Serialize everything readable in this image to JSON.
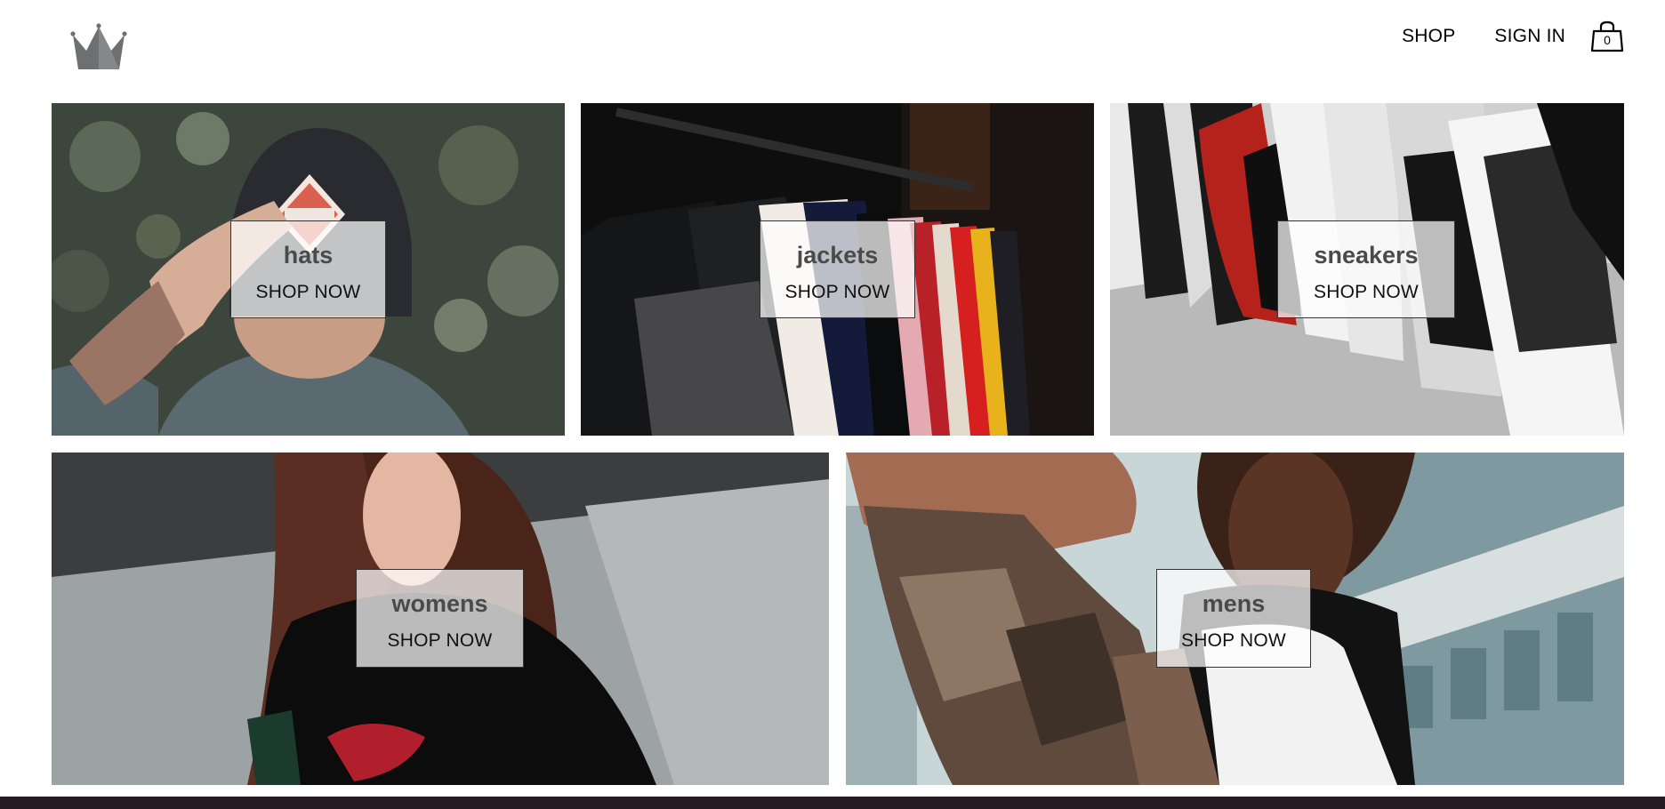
{
  "header": {
    "logo_icon": "crown-icon",
    "nav": {
      "shop_label": "SHOP",
      "signin_label": "SIGN IN"
    },
    "cart": {
      "icon": "shopping-bag-icon",
      "count": "0"
    }
  },
  "directory": {
    "items": [
      {
        "title": "hats",
        "cta": "SHOP NOW"
      },
      {
        "title": "jackets",
        "cta": "SHOP NOW"
      },
      {
        "title": "sneakers",
        "cta": "SHOP NOW"
      },
      {
        "title": "womens",
        "cta": "SHOP NOW"
      },
      {
        "title": "mens",
        "cta": "SHOP NOW"
      }
    ]
  },
  "colors": {
    "text": "#000000",
    "overlay_bg": "#ffffffb8",
    "title_text": "#4a4a4a",
    "footer_bar": "#241b20"
  }
}
